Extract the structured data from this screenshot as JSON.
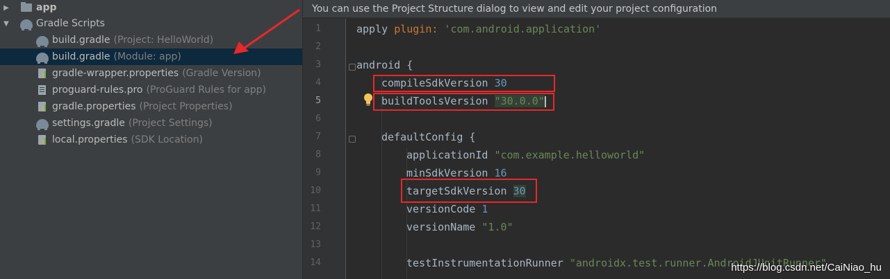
{
  "tree": {
    "items": [
      {
        "name": "app",
        "hint": "",
        "icon": "module-folder-icon"
      },
      {
        "name": "Gradle Scripts",
        "hint": "",
        "icon": "gradle-icon"
      },
      {
        "name": "build.gradle",
        "hint": "(Project: HelloWorld)",
        "icon": "gradle-icon"
      },
      {
        "name": "build.gradle",
        "hint": "(Module: app)",
        "icon": "gradle-icon"
      },
      {
        "name": "gradle-wrapper.properties",
        "hint": "(Gradle Version)",
        "icon": "properties-icon"
      },
      {
        "name": "proguard-rules.pro",
        "hint": "(ProGuard Rules for app)",
        "icon": "document-icon"
      },
      {
        "name": "gradle.properties",
        "hint": "(Project Properties)",
        "icon": "properties-icon"
      },
      {
        "name": "settings.gradle",
        "hint": "(Project Settings)",
        "icon": "gradle-icon"
      },
      {
        "name": "local.properties",
        "hint": "(SDK Location)",
        "icon": "properties-icon"
      }
    ]
  },
  "editor": {
    "banner": "You can use the Project Structure dialog to view and edit your project configuration",
    "lines": {
      "n1": "1",
      "n2": "2",
      "n3": "3",
      "n4": "4",
      "n5": "5",
      "n6": "6",
      "n7": "7",
      "n8": "8",
      "n9": "9",
      "n10": "10",
      "n11": "11",
      "n12": "12",
      "n13": "13",
      "n14": "14",
      "l1_a": "apply ",
      "l1_kw": "plugin:",
      "l1_str": " 'com.android.application'",
      "l3": "android {",
      "l4_a": "compileSdkVersion ",
      "l4_num": "30",
      "l5_a": "buildToolsVersion ",
      "l5_str": "\"30.0.0\"",
      "l7": "defaultConfig {",
      "l8_a": "applicationId ",
      "l8_str": "\"com.example.helloworld\"",
      "l9_a": "minSdkVersion ",
      "l9_num": "16",
      "l10_a": "targetSdkVersion ",
      "l10_num": "30",
      "l11_a": "versionCode ",
      "l11_num": "1",
      "l12_a": "versionName ",
      "l12_str": "\"1.0\"",
      "l14_a": "testInstrumentationRunner ",
      "l14_str": "\"androidx.test.runner.AndroidJUnitRunner\""
    },
    "current_line": 5
  },
  "watermark": "https://blog.csdn.net/CaiNiao_hu",
  "colors": {
    "highlight_box": "#e8282a",
    "arrow": "#e8282a",
    "selection": "#0d293e"
  }
}
